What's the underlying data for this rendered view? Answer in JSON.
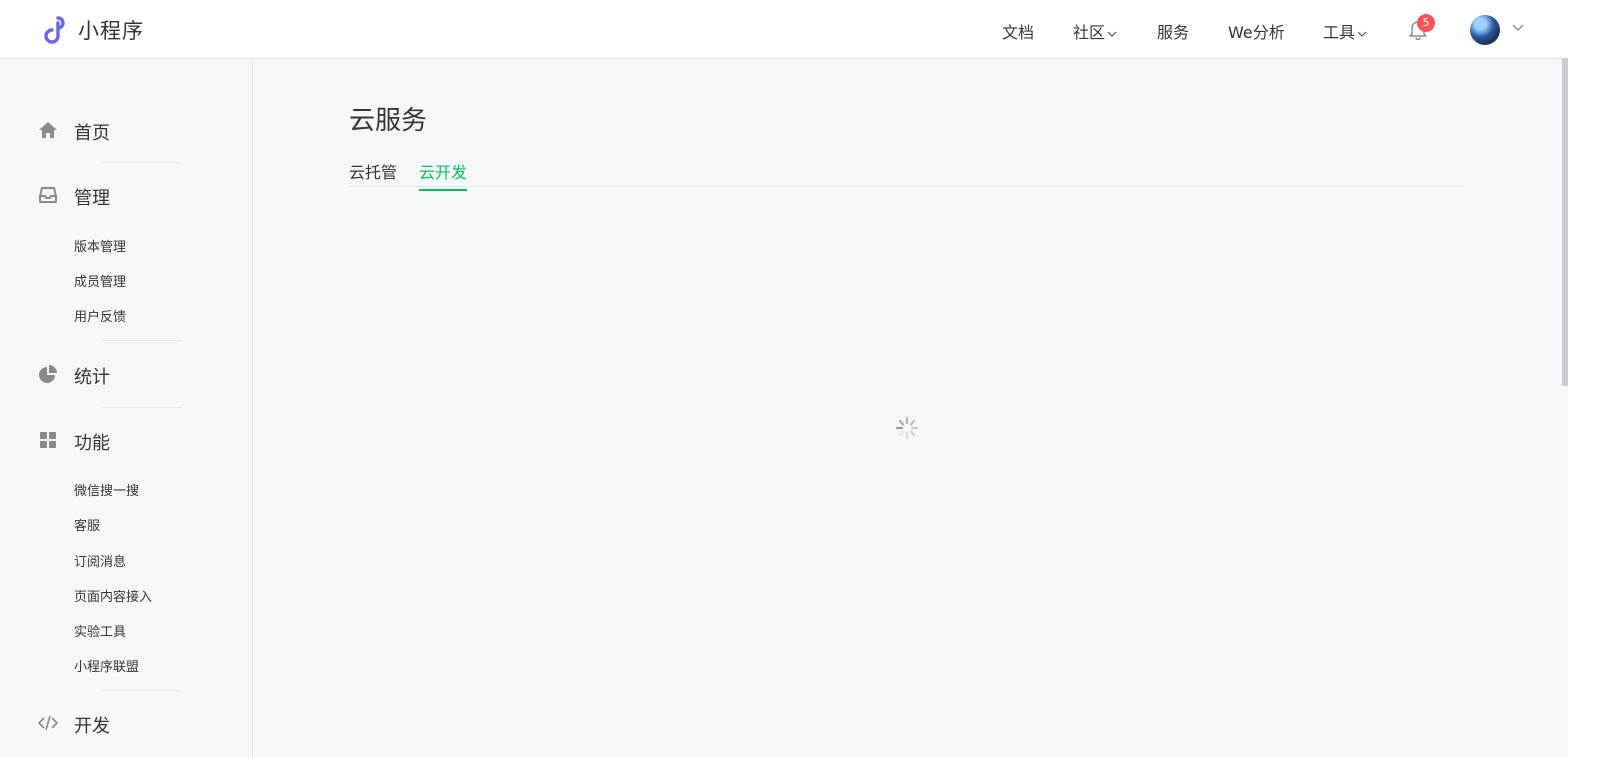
{
  "header": {
    "brand": "小程序",
    "nav": [
      {
        "label": "文档",
        "has_dropdown": false
      },
      {
        "label": "社区",
        "has_dropdown": true
      },
      {
        "label": "服务",
        "has_dropdown": false
      },
      {
        "label": "We分析",
        "has_dropdown": false
      },
      {
        "label": "工具",
        "has_dropdown": true
      }
    ],
    "notification_count": "5"
  },
  "sidebar": {
    "home": "首页",
    "manage": {
      "label": "管理",
      "items": [
        "版本管理",
        "成员管理",
        "用户反馈"
      ]
    },
    "stats": "统计",
    "features": {
      "label": "功能",
      "items": [
        "微信搜一搜",
        "客服",
        "订阅消息",
        "页面内容接入",
        "实验工具",
        "小程序联盟"
      ]
    },
    "dev": "开发"
  },
  "main": {
    "title": "云服务",
    "tabs": [
      {
        "label": "云托管",
        "active": false
      },
      {
        "label": "云开发",
        "active": true
      }
    ],
    "loading": true
  },
  "colors": {
    "accent": "#07c160",
    "badge": "#fa5151",
    "logo": "#6467f0"
  }
}
